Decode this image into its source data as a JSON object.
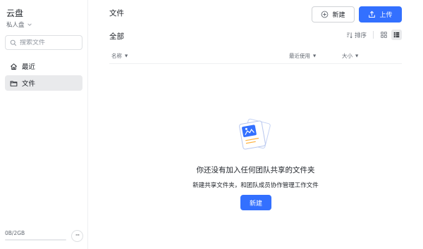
{
  "sidebar": {
    "app_title": "云盘",
    "space_label": "私人盘",
    "search_placeholder": "搜索文件",
    "items": [
      {
        "label": "最近",
        "icon": "home-icon"
      },
      {
        "label": "文件",
        "icon": "folder-icon",
        "active": true
      }
    ],
    "storage_text": "0B/2GB",
    "storage_used_fraction": 0,
    "more_label": "···"
  },
  "header": {
    "title": "文件",
    "new_label": "新建",
    "upload_label": "上传"
  },
  "toolbar": {
    "section_title": "全部",
    "sort_label": "排序",
    "active_view": "list"
  },
  "table": {
    "columns": [
      {
        "label": "名称"
      },
      {
        "label": "最近使用"
      },
      {
        "label": "大小"
      }
    ]
  },
  "empty_state": {
    "title": "你还没有加入任何团队共享的文件夹",
    "description": "新建共享文件夹，和团队成员协作管理工作文件",
    "button_label": "新建"
  },
  "colors": {
    "accent": "#3370ff",
    "active_bg": "#e9eaec"
  }
}
